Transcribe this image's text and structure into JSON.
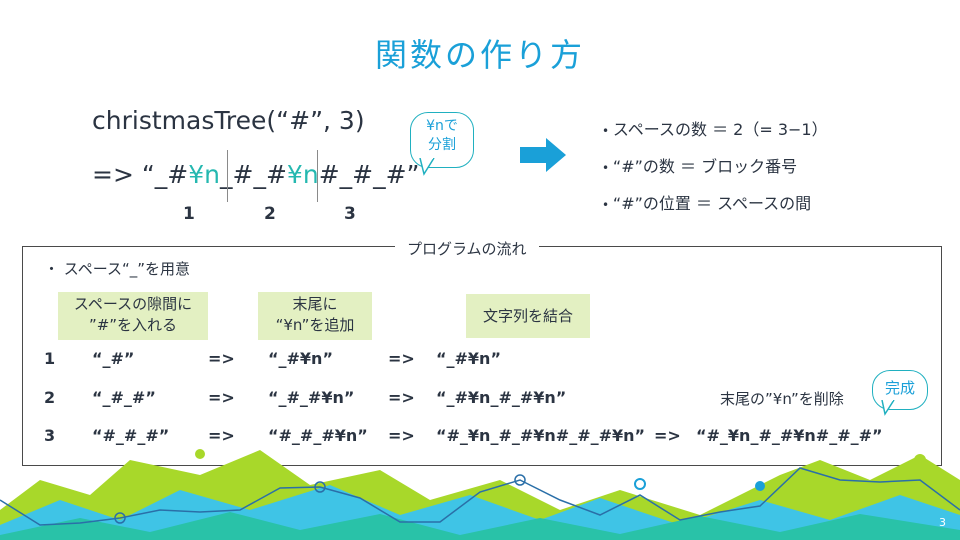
{
  "title": "関数の作り方",
  "call": "christmasTree(“#”, 3)",
  "result": {
    "prefix": "=>  “",
    "s1": "_#",
    "n1": "¥n",
    "s2": "_#_#",
    "n2": "¥n",
    "s3": "#_#_#",
    "suffix": "”"
  },
  "indices": [
    "1",
    "2",
    "3"
  ],
  "bubble_split": [
    "¥nで",
    "分割"
  ],
  "bullets": [
    "スペースの数 ＝ 2（= 3−1）",
    "“#”の数 ＝ ブロック番号",
    "“#”の位置 ＝ スペースの間"
  ],
  "flow_label": "プログラムの流れ",
  "space_note": "スペース“_”を用意",
  "step_boxes": [
    [
      "スペースの隙間に",
      "”#”を入れる"
    ],
    [
      "末尾に",
      "“¥n”を追加"
    ],
    [
      "文字列を結合"
    ]
  ],
  "rows": [
    {
      "num": "1",
      "a": "“_#”",
      "arrow1": "=>",
      "b": "“_#¥n”",
      "arrow2": "=>",
      "c": "“_#¥n”"
    },
    {
      "num": "2",
      "a": "“_#_#”",
      "arrow1": "=>",
      "b": "“_#_#¥n”",
      "arrow2": "=>",
      "c": "“_#¥n_#_#¥n”"
    },
    {
      "num": "3",
      "a": "“#_#_#”",
      "arrow1": "=>",
      "b": "“#_#_#¥n”",
      "arrow2": "=>",
      "c": "“#_¥n_#_#¥n#_#_#¥n”",
      "arrow3": "=>",
      "d": "“#_¥n_#_#¥n#_#_#”"
    }
  ],
  "delete_note": "末尾の”¥n”を削除",
  "bubble_done": "完成",
  "page_number": "3",
  "colors": {
    "accent": "#1aa0d8",
    "teal": "#25b8b0",
    "green": "#a8d82a",
    "box": "#e3f0c2"
  }
}
